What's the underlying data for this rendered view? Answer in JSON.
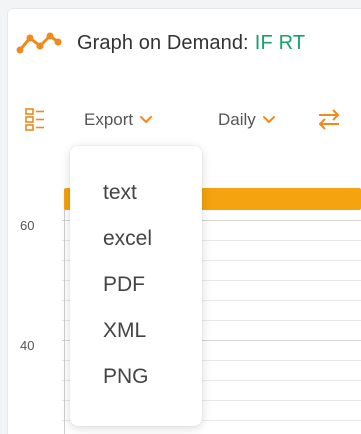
{
  "header": {
    "title": "Graph on Demand:",
    "title_accent": "IF RT",
    "accent_color": "#16a36a",
    "icon": "line-graph-icon"
  },
  "toolbar": {
    "config_icon": "column-config-icon",
    "export_label": "Export",
    "frequency_label": "Daily",
    "swap_icon": "swap-arrows-icon",
    "icon_color": "#f08a1c"
  },
  "chart": {
    "y_ticks": [
      "60",
      "40"
    ],
    "bar_color": "#f5a30e"
  },
  "export_menu": {
    "items": [
      "text",
      "excel",
      "PDF",
      "XML",
      "PNG"
    ]
  }
}
